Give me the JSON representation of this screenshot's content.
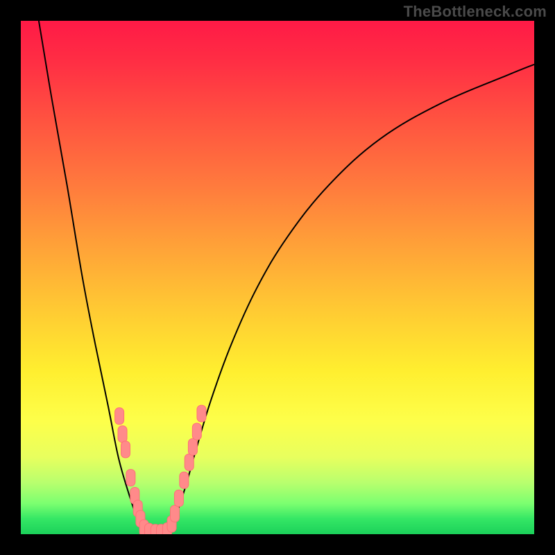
{
  "watermark": "TheBottleneck.com",
  "colors": {
    "frame": "#000000",
    "curve": "#000000",
    "marker_fill": "#ff8a8a",
    "marker_stroke": "#ff6f78"
  },
  "chart_data": {
    "type": "line",
    "title": "",
    "xlabel": "",
    "ylabel": "",
    "x_range": [
      0,
      100
    ],
    "y_range": [
      0,
      100
    ],
    "series": [
      {
        "name": "left-curve",
        "x": [
          3.5,
          6,
          9,
          12,
          14.5,
          17,
          19,
          21,
          22.7,
          24
        ],
        "y": [
          100,
          85,
          68,
          50,
          37,
          25,
          15,
          8,
          3,
          0
        ]
      },
      {
        "name": "right-curve",
        "x": [
          28.5,
          30,
          32,
          34,
          37,
          41,
          46,
          52,
          60,
          70,
          82,
          95,
          100
        ],
        "y": [
          0,
          3,
          9,
          16,
          26,
          37,
          48,
          58,
          68,
          77,
          84,
          89.5,
          91.5
        ]
      }
    ],
    "markers": {
      "name": "highlighted-points",
      "points": [
        {
          "x": 19.2,
          "y": 23.0
        },
        {
          "x": 19.8,
          "y": 19.5
        },
        {
          "x": 20.4,
          "y": 16.5
        },
        {
          "x": 21.4,
          "y": 11.0
        },
        {
          "x": 22.2,
          "y": 7.5
        },
        {
          "x": 22.8,
          "y": 5.0
        },
        {
          "x": 23.3,
          "y": 3.0
        },
        {
          "x": 24.0,
          "y": 1.2
        },
        {
          "x": 25.0,
          "y": 0.5
        },
        {
          "x": 26.2,
          "y": 0.3
        },
        {
          "x": 27.3,
          "y": 0.3
        },
        {
          "x": 28.5,
          "y": 0.6
        },
        {
          "x": 29.4,
          "y": 2.0
        },
        {
          "x": 30.0,
          "y": 4.0
        },
        {
          "x": 30.8,
          "y": 7.0
        },
        {
          "x": 31.8,
          "y": 10.5
        },
        {
          "x": 32.8,
          "y": 14.0
        },
        {
          "x": 33.5,
          "y": 17.0
        },
        {
          "x": 34.3,
          "y": 20.0
        },
        {
          "x": 35.2,
          "y": 23.5
        }
      ]
    }
  }
}
